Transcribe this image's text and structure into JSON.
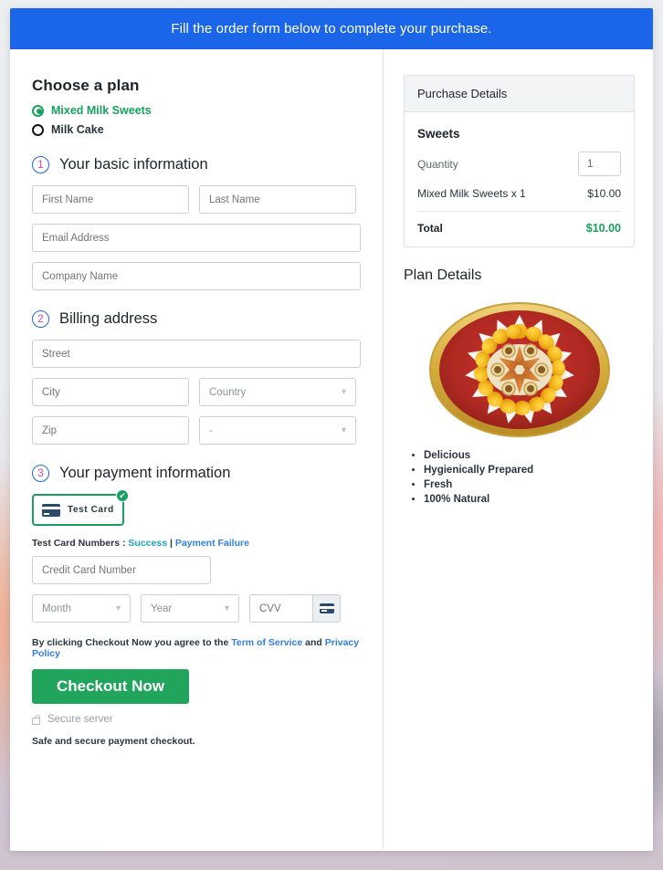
{
  "banner": {
    "text": "Fill the order form below to complete your purchase."
  },
  "plan": {
    "heading": "Choose a plan",
    "options": [
      {
        "label": "Mixed Milk Sweets",
        "selected": true
      },
      {
        "label": "Milk Cake",
        "selected": false
      }
    ]
  },
  "steps": [
    {
      "num": "1",
      "title": "Your basic information"
    },
    {
      "num": "2",
      "title": "Billing address"
    },
    {
      "num": "3",
      "title": "Your payment information"
    }
  ],
  "basic_info": {
    "first_name": "First Name",
    "last_name": "Last Name",
    "email": "Email Address",
    "company": "Company Name"
  },
  "billing": {
    "street": "Street",
    "city": "City",
    "country": "Country",
    "zip": "Zip",
    "state": "-"
  },
  "payment": {
    "tile_label": "Test Card",
    "tile_check": "✔",
    "test_numbers_prefix": "Test Card Numbers : ",
    "link_success": "Success",
    "separator": " | ",
    "link_failure": "Payment Failure",
    "card_number": "Credit Card Number",
    "month": "Month",
    "year": "Year",
    "cvv": "CVV"
  },
  "footer": {
    "terms_prefix": "By clicking Checkout Now you agree to the ",
    "terms_link": "Term of Service",
    "terms_and": " and ",
    "privacy_link": "Privacy Policy",
    "checkout_button": "Checkout Now",
    "secure_server": "Secure server",
    "safe_text": "Safe and secure payment checkout."
  },
  "purchase_details": {
    "header": "Purchase Details",
    "category": "Sweets",
    "quantity_label": "Quantity",
    "quantity_value": "1",
    "line_item": "Mixed Milk Sweets x 1",
    "line_price": "$10.00",
    "total_label": "Total",
    "total_value": "$10.00"
  },
  "plan_details": {
    "title": "Plan Details",
    "image_alt": "mixed-milk-sweets-platter",
    "features": [
      "Delicious",
      "Hygienically Prepared",
      "Fresh",
      "100% Natural"
    ]
  },
  "colors": {
    "banner_blue": "#1b66e8",
    "green": "#18a05e",
    "checkout_green": "#21a45c",
    "link_blue": "#2f7fe0",
    "link_teal": "#1fa3c4",
    "step_num_pink": "#e0409a"
  },
  "icons": {
    "chevron": "⌄",
    "credit_card": "credit-card-icon",
    "lock": "lock-icon"
  }
}
